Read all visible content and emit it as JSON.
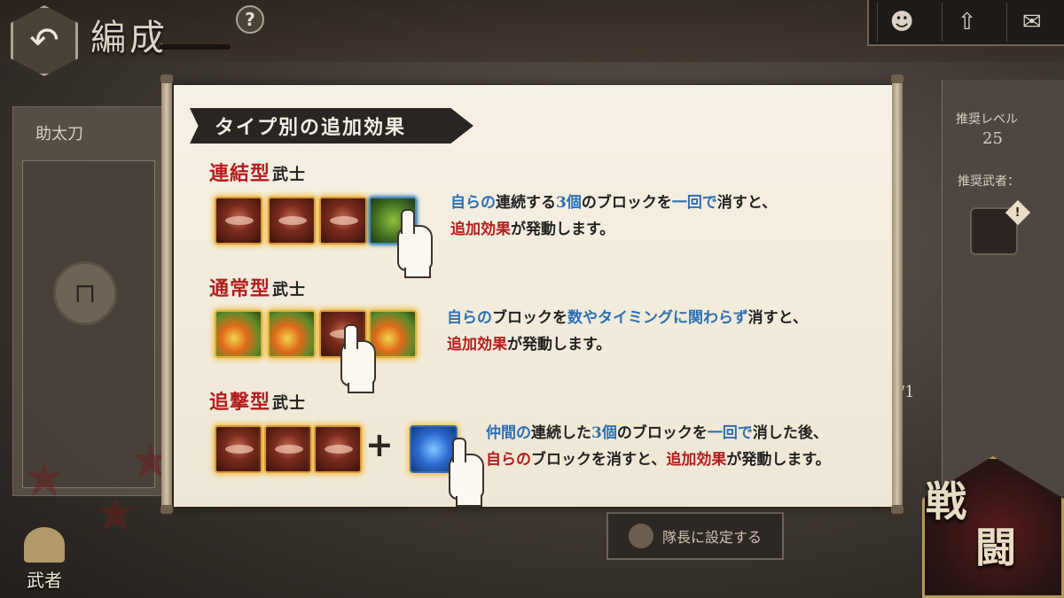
{
  "header": {
    "back_icon": "back-arrow-icon",
    "title": "編成",
    "help_label": "?"
  },
  "top_right_buttons": [
    {
      "icon": "character-icon",
      "glyph": "☻"
    },
    {
      "icon": "up-arrow-icon",
      "glyph": "⇧"
    },
    {
      "icon": "mail-icon",
      "glyph": "✉"
    }
  ],
  "left_panel": {
    "label": "助太刀",
    "lock_icon": "lock-icon"
  },
  "right_panel": {
    "recommended_level_label": "推奨レベル",
    "recommended_level_value": "25",
    "recommended_warrior_label": "推奨武者：",
    "badge": "!"
  },
  "counter_text": "/1",
  "set_leader_button": "隊長に設定する",
  "bottom_nav": {
    "label": "武者"
  },
  "battle_button": {
    "char1": "戦",
    "char2": "闘"
  },
  "dialog": {
    "section_title": "タイプ別の追加効果",
    "types": [
      {
        "name": "連結型",
        "suffix": "武士",
        "desc_line1": [
          {
            "t": "自らの",
            "c": "b"
          },
          {
            "t": "連続する",
            "c": ""
          },
          {
            "t": "3個",
            "c": "b"
          },
          {
            "t": "のブロックを",
            "c": ""
          },
          {
            "t": "一回で",
            "c": "b"
          },
          {
            "t": "消すと、",
            "c": ""
          }
        ],
        "desc_line2": [
          {
            "t": "追加効果",
            "c": "r"
          },
          {
            "t": "が発動します。",
            "c": ""
          }
        ]
      },
      {
        "name": "通常型",
        "suffix": "武士",
        "desc_line1": [
          {
            "t": "自らの",
            "c": "b"
          },
          {
            "t": "ブロックを",
            "c": ""
          },
          {
            "t": "数やタイミングに関わらず",
            "c": "b"
          },
          {
            "t": "消すと、",
            "c": ""
          }
        ],
        "desc_line2": [
          {
            "t": "追加効果",
            "c": "r"
          },
          {
            "t": "が発動します。",
            "c": ""
          }
        ]
      },
      {
        "name": "追撃型",
        "suffix": "武士",
        "desc_line1": [
          {
            "t": "仲間の",
            "c": "b"
          },
          {
            "t": "連続した",
            "c": ""
          },
          {
            "t": "3個",
            "c": "b"
          },
          {
            "t": "のブロックを",
            "c": ""
          },
          {
            "t": "一回で",
            "c": "b"
          },
          {
            "t": "消した後、",
            "c": ""
          }
        ],
        "desc_line2": [
          {
            "t": "自らの",
            "c": "r"
          },
          {
            "t": "ブロックを消すと、",
            "c": ""
          },
          {
            "t": "追加効果",
            "c": "r"
          },
          {
            "t": "が発動します。",
            "c": ""
          }
        ]
      }
    ],
    "plus": "+"
  },
  "colors": {
    "accent_red": "#b31d1d",
    "accent_blue": "#2d6fb3",
    "scroll_paper": "#f6f1e5"
  }
}
